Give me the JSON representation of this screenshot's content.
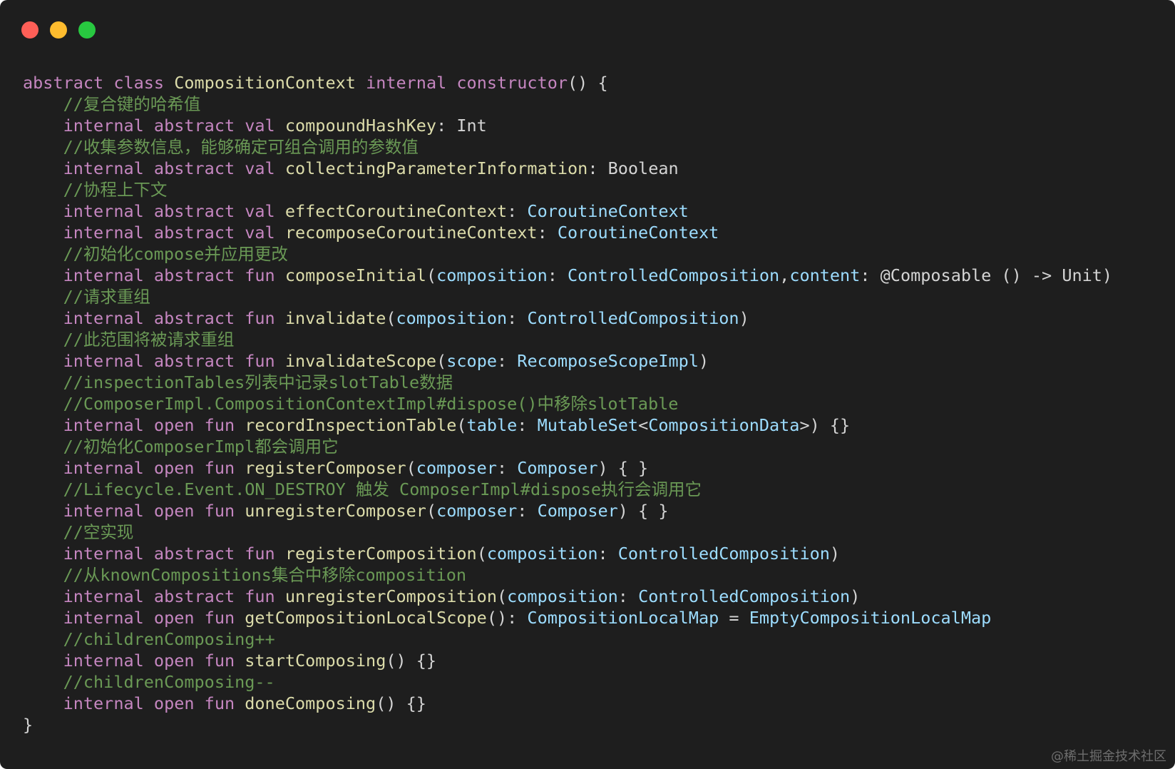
{
  "window": {
    "traffic_lights": [
      {
        "name": "close",
        "color": "#fe5f57"
      },
      {
        "name": "minimize",
        "color": "#febc2e"
      },
      {
        "name": "maximize",
        "color": "#28c840"
      }
    ]
  },
  "theme": {
    "keyword": "#c586c0",
    "type": "#e5e0a0",
    "fn": "#dcdcaa",
    "comment": "#6a9955",
    "param": "#9cdcfe",
    "type2": "#9cdcfe",
    "plain": "#d4d4d4"
  },
  "code_lines": [
    [
      [
        "k",
        "abstract class "
      ],
      [
        "f",
        "CompositionContext "
      ],
      [
        "k",
        "internal constructor"
      ],
      [
        "p",
        "() {"
      ]
    ],
    [
      [
        "p",
        "    "
      ],
      [
        "c",
        "//复合键的哈希值"
      ]
    ],
    [
      [
        "p",
        "    "
      ],
      [
        "k",
        "internal abstract val "
      ],
      [
        "f",
        "compoundHashKey"
      ],
      [
        "p",
        ": Int"
      ]
    ],
    [
      [
        "p",
        "    "
      ],
      [
        "c",
        "//收集参数信息，能够确定可组合调用的参数值"
      ]
    ],
    [
      [
        "p",
        "    "
      ],
      [
        "k",
        "internal abstract val "
      ],
      [
        "f",
        "collectingParameterInformation"
      ],
      [
        "p",
        ": Boolean"
      ]
    ],
    [
      [
        "p",
        "    "
      ],
      [
        "c",
        "//协程上下文"
      ]
    ],
    [
      [
        "p",
        "    "
      ],
      [
        "k",
        "internal abstract val "
      ],
      [
        "f",
        "effectCoroutineContext"
      ],
      [
        "p",
        ": "
      ],
      [
        "t",
        "CoroutineContext"
      ]
    ],
    [
      [
        "p",
        "    "
      ],
      [
        "k",
        "internal abstract val "
      ],
      [
        "f",
        "recomposeCoroutineContext"
      ],
      [
        "p",
        ": "
      ],
      [
        "t",
        "CoroutineContext"
      ]
    ],
    [
      [
        "p",
        "    "
      ],
      [
        "c",
        "//初始化compose并应用更改"
      ]
    ],
    [
      [
        "p",
        "    "
      ],
      [
        "k",
        "internal abstract fun "
      ],
      [
        "f",
        "composeInitial"
      ],
      [
        "p",
        "("
      ],
      [
        "a",
        "composition"
      ],
      [
        "p",
        ": "
      ],
      [
        "t",
        "ControlledComposition"
      ],
      [
        "p",
        ","
      ],
      [
        "a",
        "content"
      ],
      [
        "p",
        ": @Composable () -> Unit)"
      ]
    ],
    [
      [
        "p",
        "    "
      ],
      [
        "c",
        "//请求重组"
      ]
    ],
    [
      [
        "p",
        "    "
      ],
      [
        "k",
        "internal abstract fun "
      ],
      [
        "f",
        "invalidate"
      ],
      [
        "p",
        "("
      ],
      [
        "a",
        "composition"
      ],
      [
        "p",
        ": "
      ],
      [
        "t",
        "ControlledComposition"
      ],
      [
        "p",
        ")"
      ]
    ],
    [
      [
        "p",
        "    "
      ],
      [
        "c",
        "//此范围将被请求重组"
      ]
    ],
    [
      [
        "p",
        "    "
      ],
      [
        "k",
        "internal abstract fun "
      ],
      [
        "f",
        "invalidateScope"
      ],
      [
        "p",
        "("
      ],
      [
        "a",
        "scope"
      ],
      [
        "p",
        ": "
      ],
      [
        "t",
        "RecomposeScopeImpl"
      ],
      [
        "p",
        ")"
      ]
    ],
    [
      [
        "p",
        "    "
      ],
      [
        "c",
        "//inspectionTables列表中记录slotTable数据"
      ]
    ],
    [
      [
        "p",
        "    "
      ],
      [
        "c",
        "//ComposerImpl.CompositionContextImpl#dispose()中移除slotTable"
      ]
    ],
    [
      [
        "p",
        "    "
      ],
      [
        "k",
        "internal open fun "
      ],
      [
        "f",
        "recordInspectionTable"
      ],
      [
        "p",
        "("
      ],
      [
        "a",
        "table"
      ],
      [
        "p",
        ": "
      ],
      [
        "t",
        "MutableSet"
      ],
      [
        "p",
        "<"
      ],
      [
        "t",
        "CompositionData"
      ],
      [
        "p",
        ">) {}"
      ]
    ],
    [
      [
        "p",
        "    "
      ],
      [
        "c",
        "//初始化ComposerImpl都会调用它"
      ]
    ],
    [
      [
        "p",
        "    "
      ],
      [
        "k",
        "internal open fun "
      ],
      [
        "f",
        "registerComposer"
      ],
      [
        "p",
        "("
      ],
      [
        "a",
        "composer"
      ],
      [
        "p",
        ": "
      ],
      [
        "t",
        "Composer"
      ],
      [
        "p",
        ") { }"
      ]
    ],
    [
      [
        "p",
        "    "
      ],
      [
        "c",
        "//Lifecycle.Event.ON_DESTROY 触发 ComposerImpl#dispose执行会调用它"
      ]
    ],
    [
      [
        "p",
        "    "
      ],
      [
        "k",
        "internal open fun "
      ],
      [
        "f",
        "unregisterComposer"
      ],
      [
        "p",
        "("
      ],
      [
        "a",
        "composer"
      ],
      [
        "p",
        ": "
      ],
      [
        "t",
        "Composer"
      ],
      [
        "p",
        ") { }"
      ]
    ],
    [
      [
        "p",
        "    "
      ],
      [
        "c",
        "//空实现"
      ]
    ],
    [
      [
        "p",
        "    "
      ],
      [
        "k",
        "internal abstract fun "
      ],
      [
        "f",
        "registerComposition"
      ],
      [
        "p",
        "("
      ],
      [
        "a",
        "composition"
      ],
      [
        "p",
        ": "
      ],
      [
        "t",
        "ControlledComposition"
      ],
      [
        "p",
        ")"
      ]
    ],
    [
      [
        "p",
        "    "
      ],
      [
        "c",
        "//从knownCompositions集合中移除composition"
      ]
    ],
    [
      [
        "p",
        "    "
      ],
      [
        "k",
        "internal abstract fun "
      ],
      [
        "f",
        "unregisterComposition"
      ],
      [
        "p",
        "("
      ],
      [
        "a",
        "composition"
      ],
      [
        "p",
        ": "
      ],
      [
        "t",
        "ControlledComposition"
      ],
      [
        "p",
        ")"
      ]
    ],
    [
      [
        "p",
        "    "
      ],
      [
        "k",
        "internal open fun "
      ],
      [
        "f",
        "getCompositionLocalScope"
      ],
      [
        "p",
        "(): "
      ],
      [
        "t",
        "CompositionLocalMap"
      ],
      [
        "p",
        " = "
      ],
      [
        "t",
        "EmptyCompositionLocalMap"
      ]
    ],
    [
      [
        "p",
        "    "
      ],
      [
        "c",
        "//childrenComposing++"
      ]
    ],
    [
      [
        "p",
        "    "
      ],
      [
        "k",
        "internal open fun "
      ],
      [
        "f",
        "startComposing"
      ],
      [
        "p",
        "() {}"
      ]
    ],
    [
      [
        "p",
        "    "
      ],
      [
        "c",
        "//childrenComposing--"
      ]
    ],
    [
      [
        "p",
        "    "
      ],
      [
        "k",
        "internal open fun "
      ],
      [
        "f",
        "doneComposing"
      ],
      [
        "p",
        "() {}"
      ]
    ],
    [
      [
        "p",
        "}"
      ]
    ]
  ],
  "watermark": "@稀土掘金技术社区"
}
